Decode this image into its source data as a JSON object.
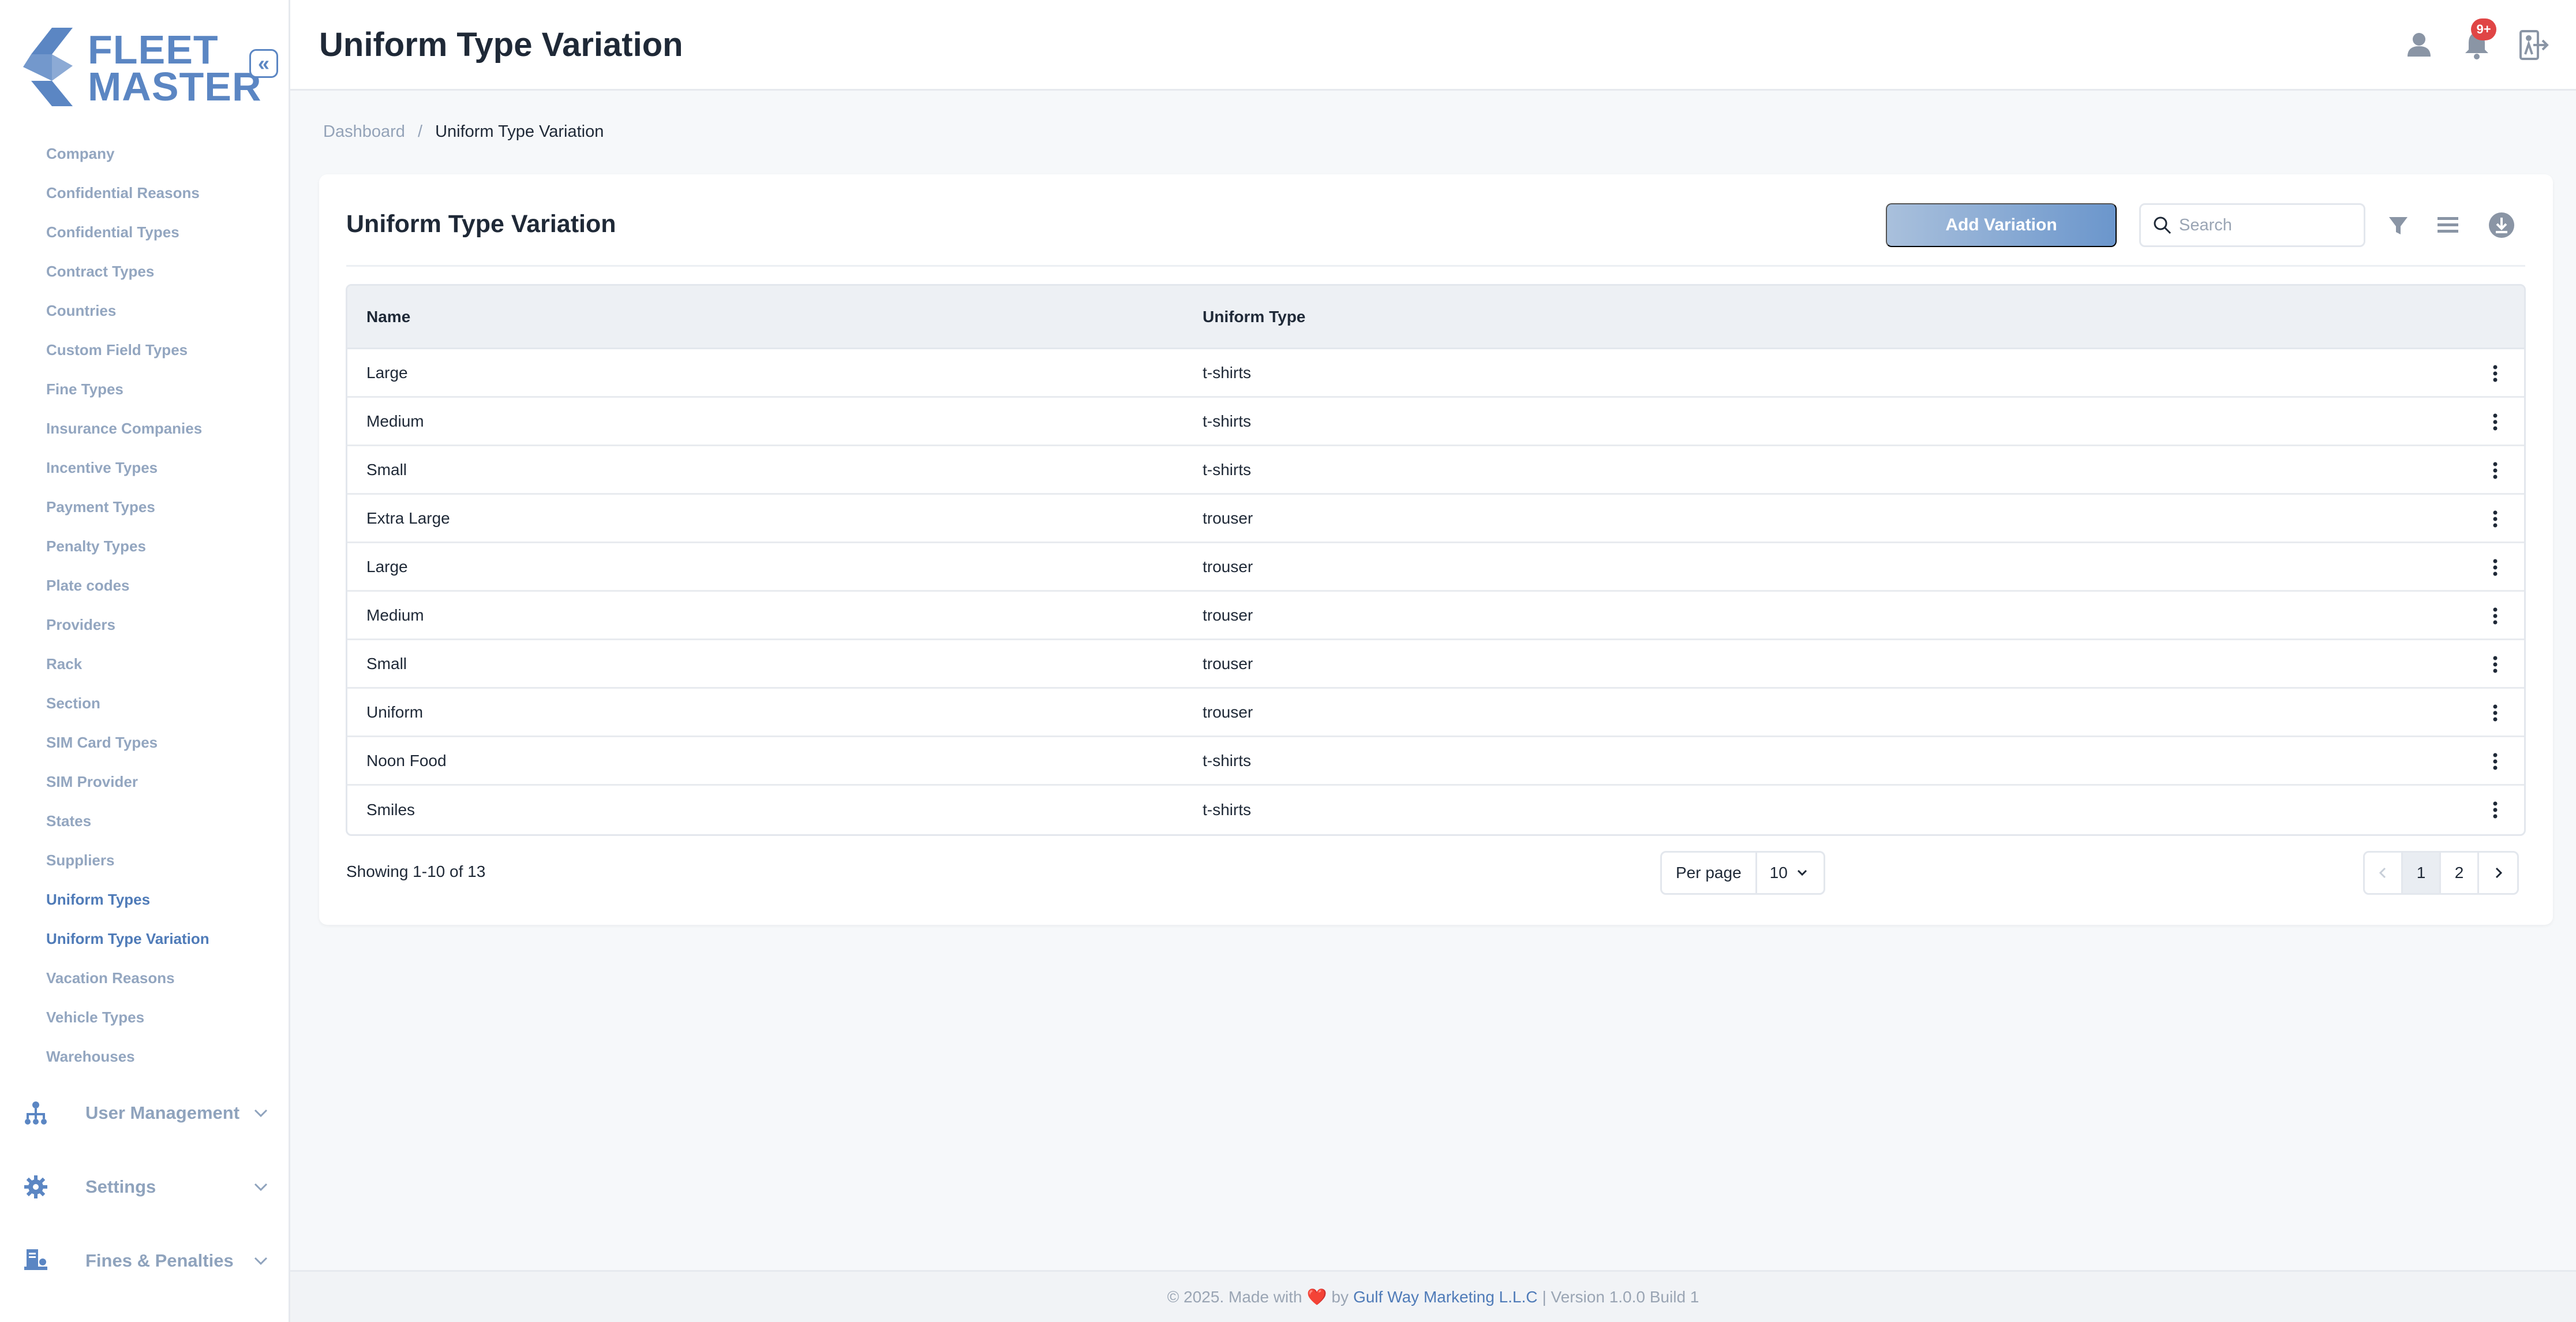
{
  "brand": {
    "line1": "FLEET",
    "line2": "MASTER",
    "color": "#5b86c3"
  },
  "sidebar": {
    "collapse_glyph": "«",
    "items": [
      {
        "label": "Company",
        "active": false
      },
      {
        "label": "Confidential Reasons",
        "active": false
      },
      {
        "label": "Confidential Types",
        "active": false
      },
      {
        "label": "Contract Types",
        "active": false
      },
      {
        "label": "Countries",
        "active": false
      },
      {
        "label": "Custom Field Types",
        "active": false
      },
      {
        "label": "Fine Types",
        "active": false
      },
      {
        "label": "Insurance Companies",
        "active": false
      },
      {
        "label": "Incentive Types",
        "active": false
      },
      {
        "label": "Payment Types",
        "active": false
      },
      {
        "label": "Penalty Types",
        "active": false
      },
      {
        "label": "Plate codes",
        "active": false
      },
      {
        "label": "Providers",
        "active": false
      },
      {
        "label": "Rack",
        "active": false
      },
      {
        "label": "Section",
        "active": false
      },
      {
        "label": "SIM Card Types",
        "active": false
      },
      {
        "label": "SIM Provider",
        "active": false
      },
      {
        "label": "States",
        "active": false
      },
      {
        "label": "Suppliers",
        "active": false
      },
      {
        "label": "Uniform Types",
        "active": true
      },
      {
        "label": "Uniform Type Variation",
        "active": true
      },
      {
        "label": "Vacation Reasons",
        "active": false
      },
      {
        "label": "Vehicle Types",
        "active": false
      },
      {
        "label": "Warehouses",
        "active": false
      }
    ],
    "groups": [
      {
        "label": "User Management",
        "icon": "org-chart-icon"
      },
      {
        "label": "Settings",
        "icon": "gear-icon"
      },
      {
        "label": "Fines & Penalties",
        "icon": "ticket-icon"
      }
    ]
  },
  "header": {
    "title": "Uniform Type Variation",
    "notification_badge": "9+",
    "icons": [
      "user-icon",
      "bell-icon",
      "logout-icon"
    ]
  },
  "breadcrumb": {
    "home": "Dashboard",
    "separator": "/",
    "current": "Uniform Type Variation"
  },
  "card": {
    "title": "Uniform Type Variation",
    "add_button": "Add Variation",
    "search_placeholder": "Search",
    "tools": [
      "filter-icon",
      "columns-icon",
      "download-icon"
    ]
  },
  "table": {
    "columns": [
      "Name",
      "Uniform Type"
    ],
    "rows": [
      {
        "name": "Large",
        "type": "t-shirts"
      },
      {
        "name": "Medium",
        "type": "t-shirts"
      },
      {
        "name": "Small",
        "type": "t-shirts"
      },
      {
        "name": "Extra Large",
        "type": "trouser"
      },
      {
        "name": "Large",
        "type": "trouser"
      },
      {
        "name": "Medium",
        "type": "trouser"
      },
      {
        "name": "Small",
        "type": "trouser"
      },
      {
        "name": "Uniform",
        "type": "trouser"
      },
      {
        "name": "Noon Food",
        "type": "t-shirts"
      },
      {
        "name": "Smiles",
        "type": "t-shirts"
      }
    ]
  },
  "pagination": {
    "showing": "Showing 1-10 of 13",
    "per_page_label": "Per page",
    "per_page_value": "10",
    "pages": [
      "1",
      "2"
    ],
    "current_page": "1"
  },
  "footer": {
    "prefix": "© 2025. Made with",
    "heart": "❤️",
    "by": "by",
    "company": "Gulf Way Marketing L.L.C",
    "suffix": "| Version 1.0.0 Build 1"
  }
}
